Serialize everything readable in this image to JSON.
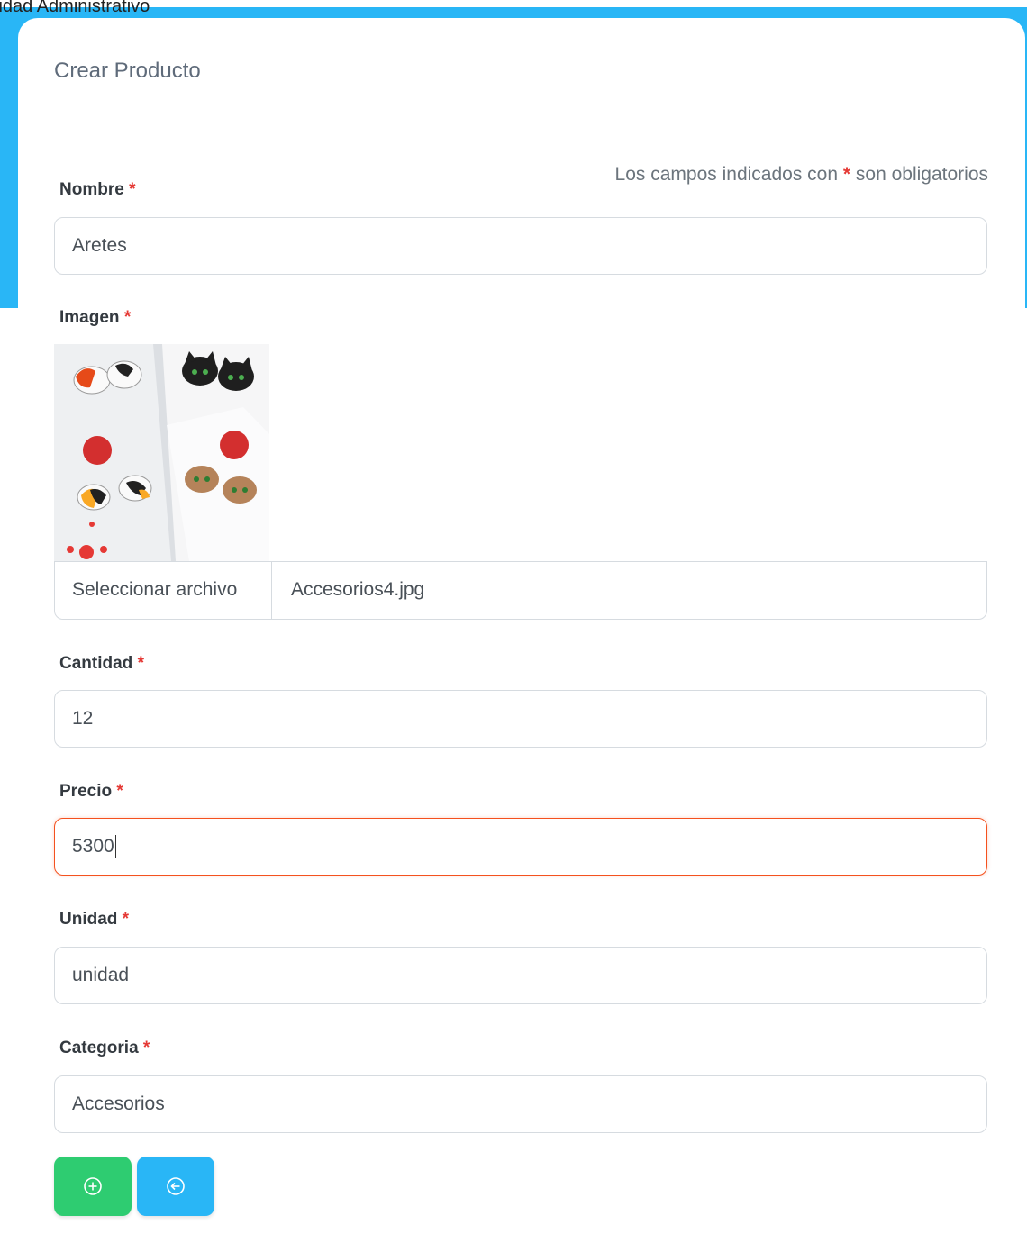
{
  "page": {
    "caption": "lidad Administrativo"
  },
  "form": {
    "title": "Crear Producto",
    "required_note_prefix": "Los campos indicados con",
    "required_star": "*",
    "required_note_suffix": "son obligatorios",
    "fields": {
      "nombre": {
        "label": "Nombre",
        "value": "Aretes"
      },
      "imagen": {
        "label": "Imagen",
        "button_label": "Seleccionar archivo",
        "file_name": "Accesorios4.jpg"
      },
      "cantidad": {
        "label": "Cantidad",
        "value": "12"
      },
      "precio": {
        "label": "Precio",
        "value": "5300"
      },
      "unidad": {
        "label": "Unidad",
        "value": "unidad"
      },
      "categoria": {
        "label": "Categoria",
        "value": "Accesorios"
      }
    },
    "buttons": {
      "add": {
        "icon": "plus-circle-icon",
        "color": "#2ecc71"
      },
      "back": {
        "icon": "arrow-left-circle-icon",
        "color": "#29b6f6"
      }
    }
  }
}
